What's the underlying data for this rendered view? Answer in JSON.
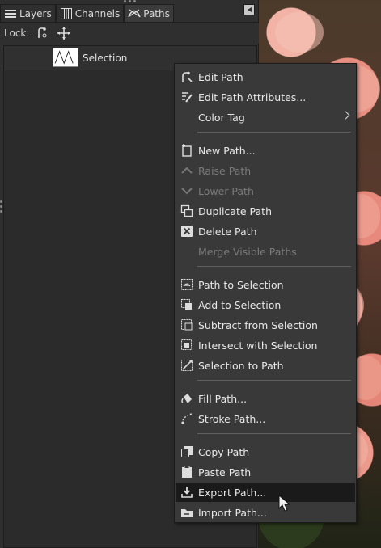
{
  "tabs": [
    {
      "label": "Layers",
      "icon": "layers-icon",
      "active": false
    },
    {
      "label": "Channels",
      "icon": "channels-icon",
      "active": false
    },
    {
      "label": "Paths",
      "icon": "paths-icon",
      "active": true
    }
  ],
  "lockbar": {
    "label": "Lock:"
  },
  "paths": [
    {
      "name": "Selection"
    }
  ],
  "menu": {
    "items": [
      {
        "label": "Edit Path",
        "icon": "edit-path-icon",
        "enabled": true
      },
      {
        "label": "Edit Path Attributes...",
        "icon": "edit-attributes-icon",
        "enabled": true
      },
      {
        "label": "Color Tag",
        "icon": "",
        "enabled": true,
        "submenu": true
      },
      {
        "label": "New Path...",
        "icon": "new-path-icon",
        "enabled": true
      },
      {
        "label": "Raise Path",
        "icon": "raise-icon",
        "enabled": false
      },
      {
        "label": "Lower Path",
        "icon": "lower-icon",
        "enabled": false
      },
      {
        "label": "Duplicate Path",
        "icon": "duplicate-icon",
        "enabled": true
      },
      {
        "label": "Delete Path",
        "icon": "delete-icon",
        "enabled": true
      },
      {
        "label": "Merge Visible Paths",
        "icon": "",
        "enabled": false
      },
      {
        "label": "Path to Selection",
        "icon": "path-to-selection-icon",
        "enabled": true
      },
      {
        "label": "Add to Selection",
        "icon": "add-selection-icon",
        "enabled": true
      },
      {
        "label": "Subtract from Selection",
        "icon": "subtract-selection-icon",
        "enabled": true
      },
      {
        "label": "Intersect with Selection",
        "icon": "intersect-selection-icon",
        "enabled": true
      },
      {
        "label": "Selection to Path",
        "icon": "selection-to-path-icon",
        "enabled": true
      },
      {
        "label": "Fill Path...",
        "icon": "fill-icon",
        "enabled": true
      },
      {
        "label": "Stroke Path...",
        "icon": "stroke-icon",
        "enabled": true
      },
      {
        "label": "Copy Path",
        "icon": "copy-icon",
        "enabled": true
      },
      {
        "label": "Paste Path",
        "icon": "paste-icon",
        "enabled": true
      },
      {
        "label": "Export Path...",
        "icon": "export-icon",
        "enabled": true,
        "highlighted": true
      },
      {
        "label": "Import Path...",
        "icon": "import-icon",
        "enabled": true
      }
    ]
  },
  "colors": {
    "menu_bg": "#393939",
    "highlight": "#1a1a1a",
    "panel_bg": "#2f2f2f",
    "disabled_text": "#7a7a7a"
  }
}
